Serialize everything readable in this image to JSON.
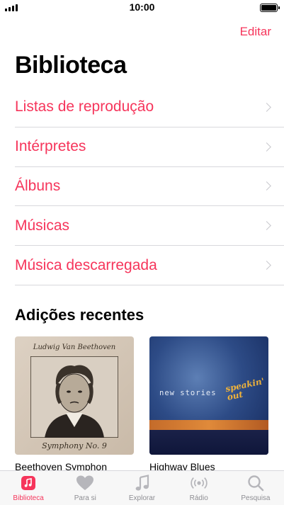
{
  "status_bar": {
    "time": "10:00",
    "battery_level": 1.0
  },
  "header": {
    "edit_label": "Editar",
    "title": "Biblioteca"
  },
  "library": {
    "items": [
      {
        "label": "Listas de reprodução"
      },
      {
        "label": "Intérpretes"
      },
      {
        "label": "Álbuns"
      },
      {
        "label": "Músicas"
      },
      {
        "label": "Música descarregada"
      }
    ]
  },
  "recent": {
    "title": "Adições recentes",
    "albums": [
      {
        "name": "Beethoven Symphon",
        "cover_text_top": "Ludwig Van Beethoven",
        "cover_text_bottom": "Symphony No. 9"
      },
      {
        "name": "Highway Blues",
        "cover_text_main": "new stories",
        "cover_text_accent": "speakin' out"
      }
    ]
  },
  "tabs": [
    {
      "label": "Biblioteca",
      "icon": "library-icon",
      "active": true
    },
    {
      "label": "Para si",
      "icon": "heart-icon",
      "active": false
    },
    {
      "label": "Explorar",
      "icon": "music-note-icon",
      "active": false
    },
    {
      "label": "Rádio",
      "icon": "radio-icon",
      "active": false
    },
    {
      "label": "Pesquisa",
      "icon": "search-icon",
      "active": false
    }
  ],
  "colors": {
    "accent": "#f6355b",
    "inactive": "#8e8e93"
  }
}
